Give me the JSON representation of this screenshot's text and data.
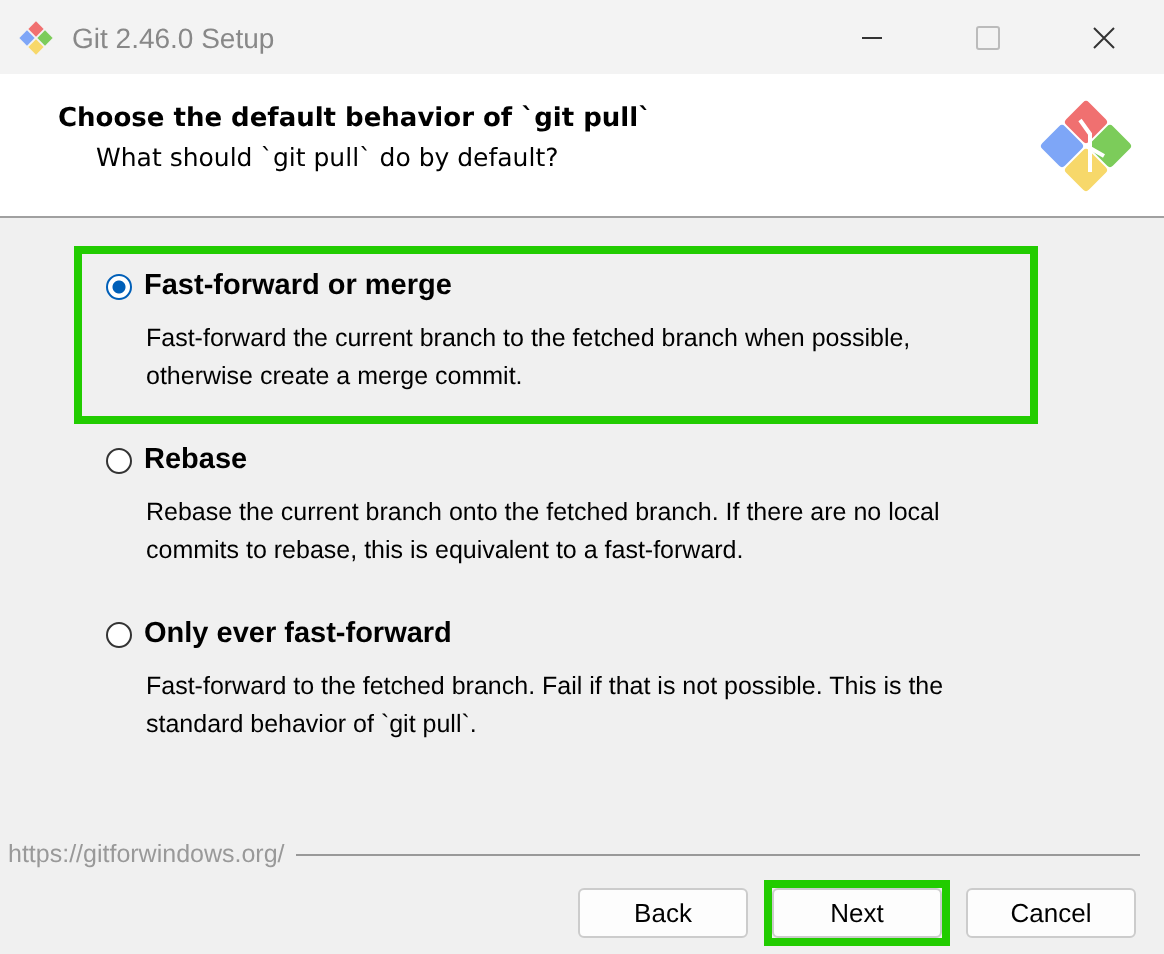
{
  "window": {
    "title": "Git 2.46.0 Setup"
  },
  "header": {
    "title": "Choose the default behavior of `git pull`",
    "subtitle": "What should `git pull` do by default?"
  },
  "options": [
    {
      "label": "Fast-forward or merge",
      "description": "Fast-forward the current branch to the fetched branch when possible, otherwise create a merge commit.",
      "selected": true,
      "highlighted": true
    },
    {
      "label": "Rebase",
      "description": "Rebase the current branch onto the fetched branch. If there are no local commits to rebase, this is equivalent to a fast-forward.",
      "selected": false,
      "highlighted": false
    },
    {
      "label": "Only ever fast-forward",
      "description": "Fast-forward to the fetched branch. Fail if that is not possible. This is the standard behavior of `git pull`.",
      "selected": false,
      "highlighted": false
    }
  ],
  "footer_link": "https://gitforwindows.org/",
  "buttons": [
    {
      "label": "Back",
      "highlighted": false
    },
    {
      "label": "Next",
      "highlighted": true
    },
    {
      "label": "Cancel",
      "highlighted": false
    }
  ]
}
